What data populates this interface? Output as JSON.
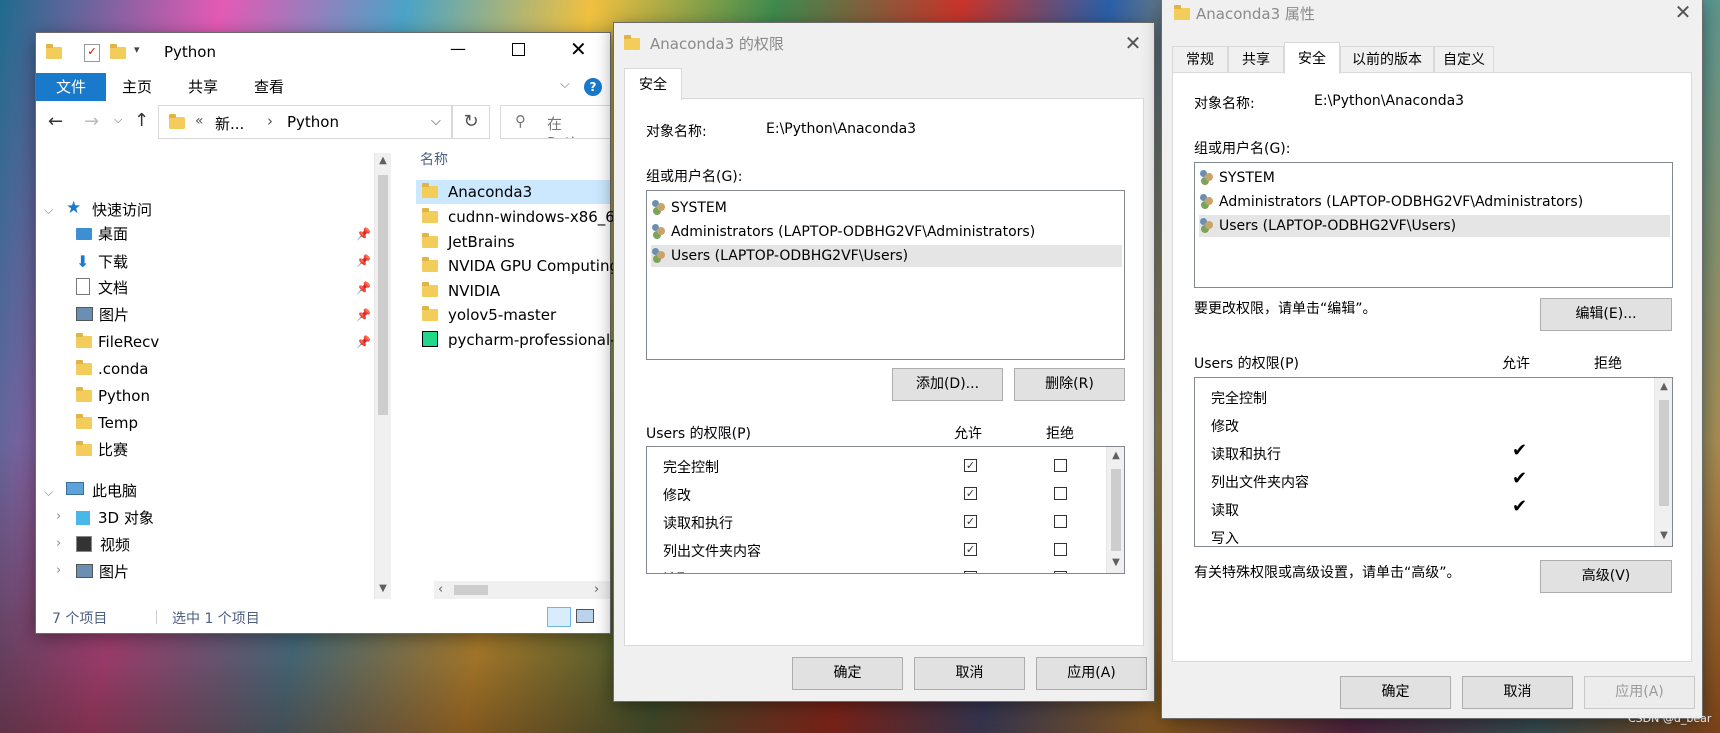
{
  "explorer": {
    "title": "Python",
    "ribbon_tabs": [
      "文件",
      "主页",
      "共享",
      "查看"
    ],
    "address": {
      "prefix": "«",
      "crumb1": "新...",
      "crumb2": "Python"
    },
    "search_placeholder": "在 Python 中",
    "nav_quick_access": "快速访问",
    "nav_items": [
      "桌面",
      "下载",
      "文档",
      "图片",
      "FileRecv",
      ".conda",
      "Python",
      "Temp",
      "比赛"
    ],
    "nav_this_pc": "此电脑",
    "nav_pc_items": [
      "3D 对象",
      "视频",
      "图片"
    ],
    "column_header": "名称",
    "files": [
      "Anaconda3",
      "cudnn-windows-x86_6",
      "JetBrains",
      "NVIDA GPU Computing",
      "NVIDIA",
      "yolov5-master",
      "pycharm-professional-"
    ],
    "status_count": "7 个项目",
    "status_selected": "选中 1 个项目"
  },
  "perm_dialog": {
    "title": "Anaconda3 的权限",
    "tab": "安全",
    "object_label": "对象名称:",
    "object_value": "E:\\Python\\Anaconda3",
    "group_label": "组或用户名(G):",
    "users": [
      "SYSTEM",
      "Administrators (LAPTOP-ODBHG2VF\\Administrators)",
      "Users (LAPTOP-ODBHG2VF\\Users)"
    ],
    "add_button": "添加(D)...",
    "remove_button": "删除(R)",
    "perm_label": "Users 的权限(P)",
    "allow_header": "允许",
    "deny_header": "拒绝",
    "permissions": [
      "完全控制",
      "修改",
      "读取和执行",
      "列出文件夹内容",
      "读取"
    ],
    "allow_checked": [
      true,
      true,
      true,
      true,
      true
    ],
    "deny_checked": [
      false,
      false,
      false,
      false,
      false
    ],
    "ok": "确定",
    "cancel": "取消",
    "apply": "应用(A)"
  },
  "props_dialog": {
    "title": "Anaconda3 属性",
    "tabs": [
      "常规",
      "共享",
      "安全",
      "以前的版本",
      "自定义"
    ],
    "active_tab": "安全",
    "object_label": "对象名称:",
    "object_value": "E:\\Python\\Anaconda3",
    "group_label": "组或用户名(G):",
    "users": [
      "SYSTEM",
      "Administrators (LAPTOP-ODBHG2VF\\Administrators)",
      "Users (LAPTOP-ODBHG2VF\\Users)"
    ],
    "edit_hint": "要更改权限，请单击“编辑”。",
    "edit_button": "编辑(E)...",
    "perm_label": "Users 的权限(P)",
    "allow_header": "允许",
    "deny_header": "拒绝",
    "permissions": [
      "完全控制",
      "修改",
      "读取和执行",
      "列出文件夹内容",
      "读取",
      "写入"
    ],
    "allow_marks": [
      false,
      false,
      true,
      true,
      true,
      false
    ],
    "advanced_hint": "有关特殊权限或高级设置，请单击“高级”。",
    "advanced_button": "高级(V)",
    "ok": "确定",
    "cancel": "取消",
    "apply": "应用(A)"
  },
  "watermark": "CSDN @d_bear"
}
